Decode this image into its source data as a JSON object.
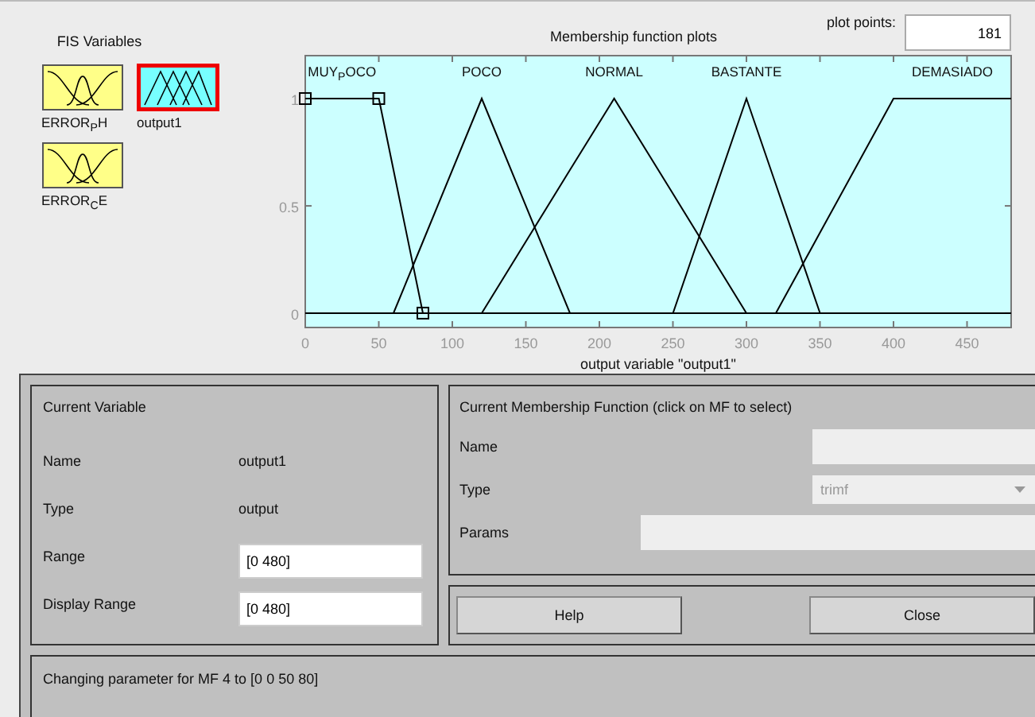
{
  "fis_variables": {
    "title": "FIS Variables",
    "items": [
      {
        "name": "ERROR$_{P}$H",
        "kind": "input",
        "selected": false
      },
      {
        "name": "output1",
        "kind": "output",
        "selected": true
      },
      {
        "name": "ERROR$_{C}$E",
        "kind": "input",
        "selected": false
      }
    ]
  },
  "plot_points": {
    "label": "plot points:",
    "value": "181"
  },
  "chart_data": {
    "type": "line",
    "title": "Membership function plots",
    "xlabel": "output variable \"output1\"",
    "x": [
      0,
      50,
      60,
      80,
      120,
      180,
      210,
      250,
      300,
      320,
      350,
      400,
      480
    ],
    "series": [
      {
        "name": "MUY$_{P}$OCO",
        "color": "#000000",
        "values": [
          1,
          1,
          0.667,
          0,
          0,
          0,
          0,
          0,
          0,
          0,
          0,
          0,
          0
        ]
      },
      {
        "name": "POCO",
        "color": "#000000",
        "values": [
          0,
          0,
          0,
          0.333,
          1,
          0,
          0,
          0,
          0,
          0,
          0,
          0,
          0
        ]
      },
      {
        "name": "NORMAL",
        "color": "#000000",
        "values": [
          0,
          0,
          0,
          0,
          0,
          0.667,
          1,
          0.556,
          0,
          0,
          0,
          0,
          0
        ]
      },
      {
        "name": "BASTANTE",
        "color": "#000000",
        "values": [
          0,
          0,
          0,
          0,
          0,
          0,
          0,
          0,
          1,
          0.6,
          0,
          0,
          0
        ]
      },
      {
        "name": "DEMASIADO",
        "color": "#000000",
        "values": [
          0,
          0,
          0,
          0,
          0,
          0,
          0,
          0,
          0,
          0,
          0.375,
          1,
          1
        ]
      }
    ],
    "xlim": [
      0,
      480
    ],
    "ylim": [
      -0.067,
      1.2
    ],
    "xticks": [
      0,
      50,
      100,
      150,
      200,
      250,
      300,
      350,
      400,
      450
    ],
    "yticks": [
      0,
      0.5,
      1
    ]
  },
  "mf_selection": [
    {
      "selected": true
    },
    {
      "selected": false
    },
    {
      "selected": false
    },
    {
      "selected": false
    },
    {
      "selected": false
    }
  ],
  "current_variable": {
    "title": "Current Variable",
    "fields": [
      {
        "label": "Name",
        "value": "output1",
        "kind": "text"
      },
      {
        "label": "Type",
        "value": "output",
        "kind": "text"
      },
      {
        "label": "Range",
        "value": "[0 480]",
        "kind": "input"
      },
      {
        "label": "Display Range",
        "value": "[0 480]",
        "kind": "input"
      }
    ]
  },
  "current_mf": {
    "title": "Current Membership Function (click on MF to select)",
    "fields": [
      {
        "label": "Name",
        "kind": "input"
      },
      {
        "label": "Type",
        "kind": "dropdown",
        "value": "trimf",
        "disabled": true
      },
      {
        "label": "Params",
        "kind": "wide"
      }
    ]
  },
  "buttons": [
    "Help",
    "Close"
  ],
  "status": "Changing parameter for MF 4 to  [0 0 50 80]"
}
